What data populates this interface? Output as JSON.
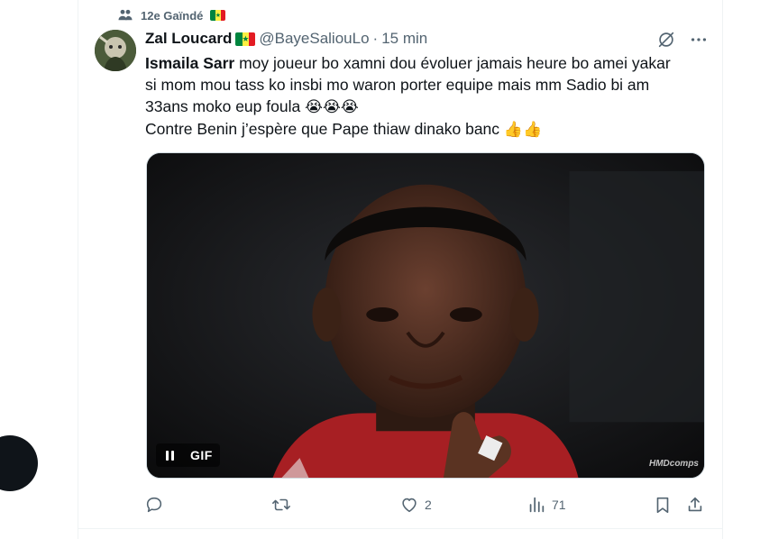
{
  "community": {
    "name": "12e Gaïndé",
    "icon": "community-icon"
  },
  "author": {
    "display_name": "Zal Loucard",
    "handle": "@BayeSaliouLo",
    "separator": "·",
    "time": "15 min",
    "avatar": "avatar-image"
  },
  "tweet": {
    "mention": "Ismaila Sarr",
    "line1_rest": " moy joueur bo xamni dou évoluer jamais heure bo amei yakar",
    "line2": "si mom mou tass ko  insbi mo waron porter equipe mais mm Sadio bi am",
    "line3": "33ans moko eup foula",
    "line3_emoji": "😭😭😭",
    "line4": "Contre Benin j’espère que Pape thiaw dinako banc",
    "line4_emoji": "👍👍"
  },
  "media": {
    "gif_label": "GIF",
    "watermark": "HMDcomps",
    "controls": [
      "pause-icon"
    ]
  },
  "actions": {
    "reply_count": "",
    "repost_count": "",
    "like_count": "2",
    "views_count": "71"
  },
  "colors": {
    "text_primary": "#0f1419",
    "text_secondary": "#536471",
    "border": "#eff3f4",
    "flag_green": "#00853f",
    "flag_yellow": "#fdef42",
    "flag_red": "#e31b23"
  }
}
